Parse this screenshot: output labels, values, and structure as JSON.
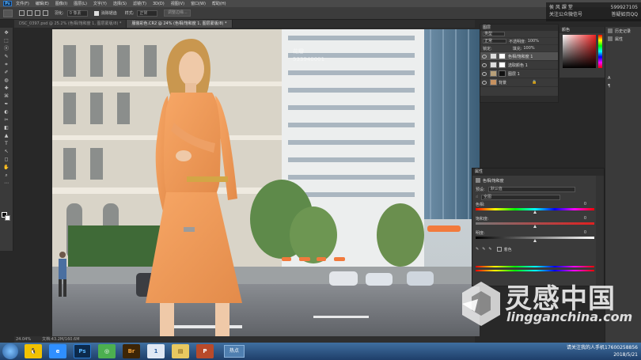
{
  "menubar": {
    "logo": "Ps",
    "items": [
      "文件(F)",
      "编辑(E)",
      "图像(I)",
      "图层(L)",
      "文字(Y)",
      "选择(S)",
      "滤镜(T)",
      "3D(D)",
      "视图(V)",
      "窗口(W)",
      "帮助(H)"
    ]
  },
  "options": {
    "feather_label": "羽化:",
    "feather_value": "0 像素",
    "antialias_label": "消除锯齿",
    "style_label": "样式:",
    "style_value": "正常",
    "refine_button": "调整边缘..."
  },
  "watermark_top": {
    "line1_left": "侯 风 課 堂",
    "line1_right": "599927105",
    "line2_left": "关注公众微信号",
    "line2_right": "答疑如页QQ"
  },
  "tabs": [
    {
      "label": "DSC_0397.psd @ 25.2% (色相/饱和度 1, 图层蒙版/8) *",
      "active": false
    },
    {
      "label": "服装彩色.CR2 @ 24% (色相/饱和度 1, 图层蒙版/8) *",
      "active": true
    }
  ],
  "toolbar": {
    "tools": [
      "✥",
      "⬚",
      "ⓞ",
      "✎",
      "⌗",
      "✐",
      "◍",
      "✚",
      "⌘",
      "✒",
      "◐",
      "✂",
      "◧",
      "▲",
      "T",
      "↖",
      "◻",
      "✋",
      "⌕",
      "⋯"
    ]
  },
  "status": {
    "zoom": "24.04%",
    "doc": "文档:43.2M/160.6M"
  },
  "camera_overlay": {
    "line1": "花瓣",
    "line2": "533940001"
  },
  "color_panel": {
    "title": "颜色"
  },
  "right_strip": {
    "items": [
      "历史记录",
      "属性"
    ],
    "icon_a": "A",
    "icon_para": "¶"
  },
  "layers": {
    "title": "图层",
    "kind_label": "类型",
    "mode_label": "正常",
    "opacity_label": "不透明度:",
    "opacity_value": "100%",
    "lock_label": "锁定:",
    "fill_label": "填充:",
    "fill_value": "100%",
    "items": [
      {
        "name": "色相/饱和度 1",
        "selected": true
      },
      {
        "name": "选取颜色 1",
        "selected": false
      },
      {
        "name": "图层 1",
        "selected": false
      },
      {
        "name": "背景",
        "selected": false
      }
    ]
  },
  "properties": {
    "title": "属性",
    "panel_title": "色相/饱和度",
    "preset_label": "预设:",
    "preset_value": "默认值",
    "channel_value": "全图",
    "hue_label": "色相:",
    "hue_value": "0",
    "saturation_label": "饱和度:",
    "saturation_value": "0",
    "lightness_label": "明度:",
    "lightness_value": "0",
    "colorize_label": "着色"
  },
  "taskbar": {
    "apps": [
      {
        "name": "qq",
        "label": "🐧",
        "color": "#f2c200"
      },
      {
        "name": "ie",
        "label": "e",
        "color": "#2f8fff"
      },
      {
        "name": "photoshop",
        "label": "Ps",
        "color": "#0c2a4c"
      },
      {
        "name": "chrome",
        "label": "◎",
        "color": "#4caf50"
      },
      {
        "name": "bridge",
        "label": "Br",
        "color": "#3d2506"
      },
      {
        "name": "media",
        "label": "1",
        "color": "#e0e8f4"
      },
      {
        "name": "explorer",
        "label": "▤",
        "color": "#e8c860"
      },
      {
        "name": "powerpoint",
        "label": "P",
        "color": "#b84a2a"
      }
    ],
    "task_label": "热点",
    "tray_line1": "请关注我的人手机17600258856",
    "tray_date": "2018/5/21"
  },
  "watermark_logo": {
    "zh": "灵感中国",
    "en": "lingganchina.com"
  }
}
